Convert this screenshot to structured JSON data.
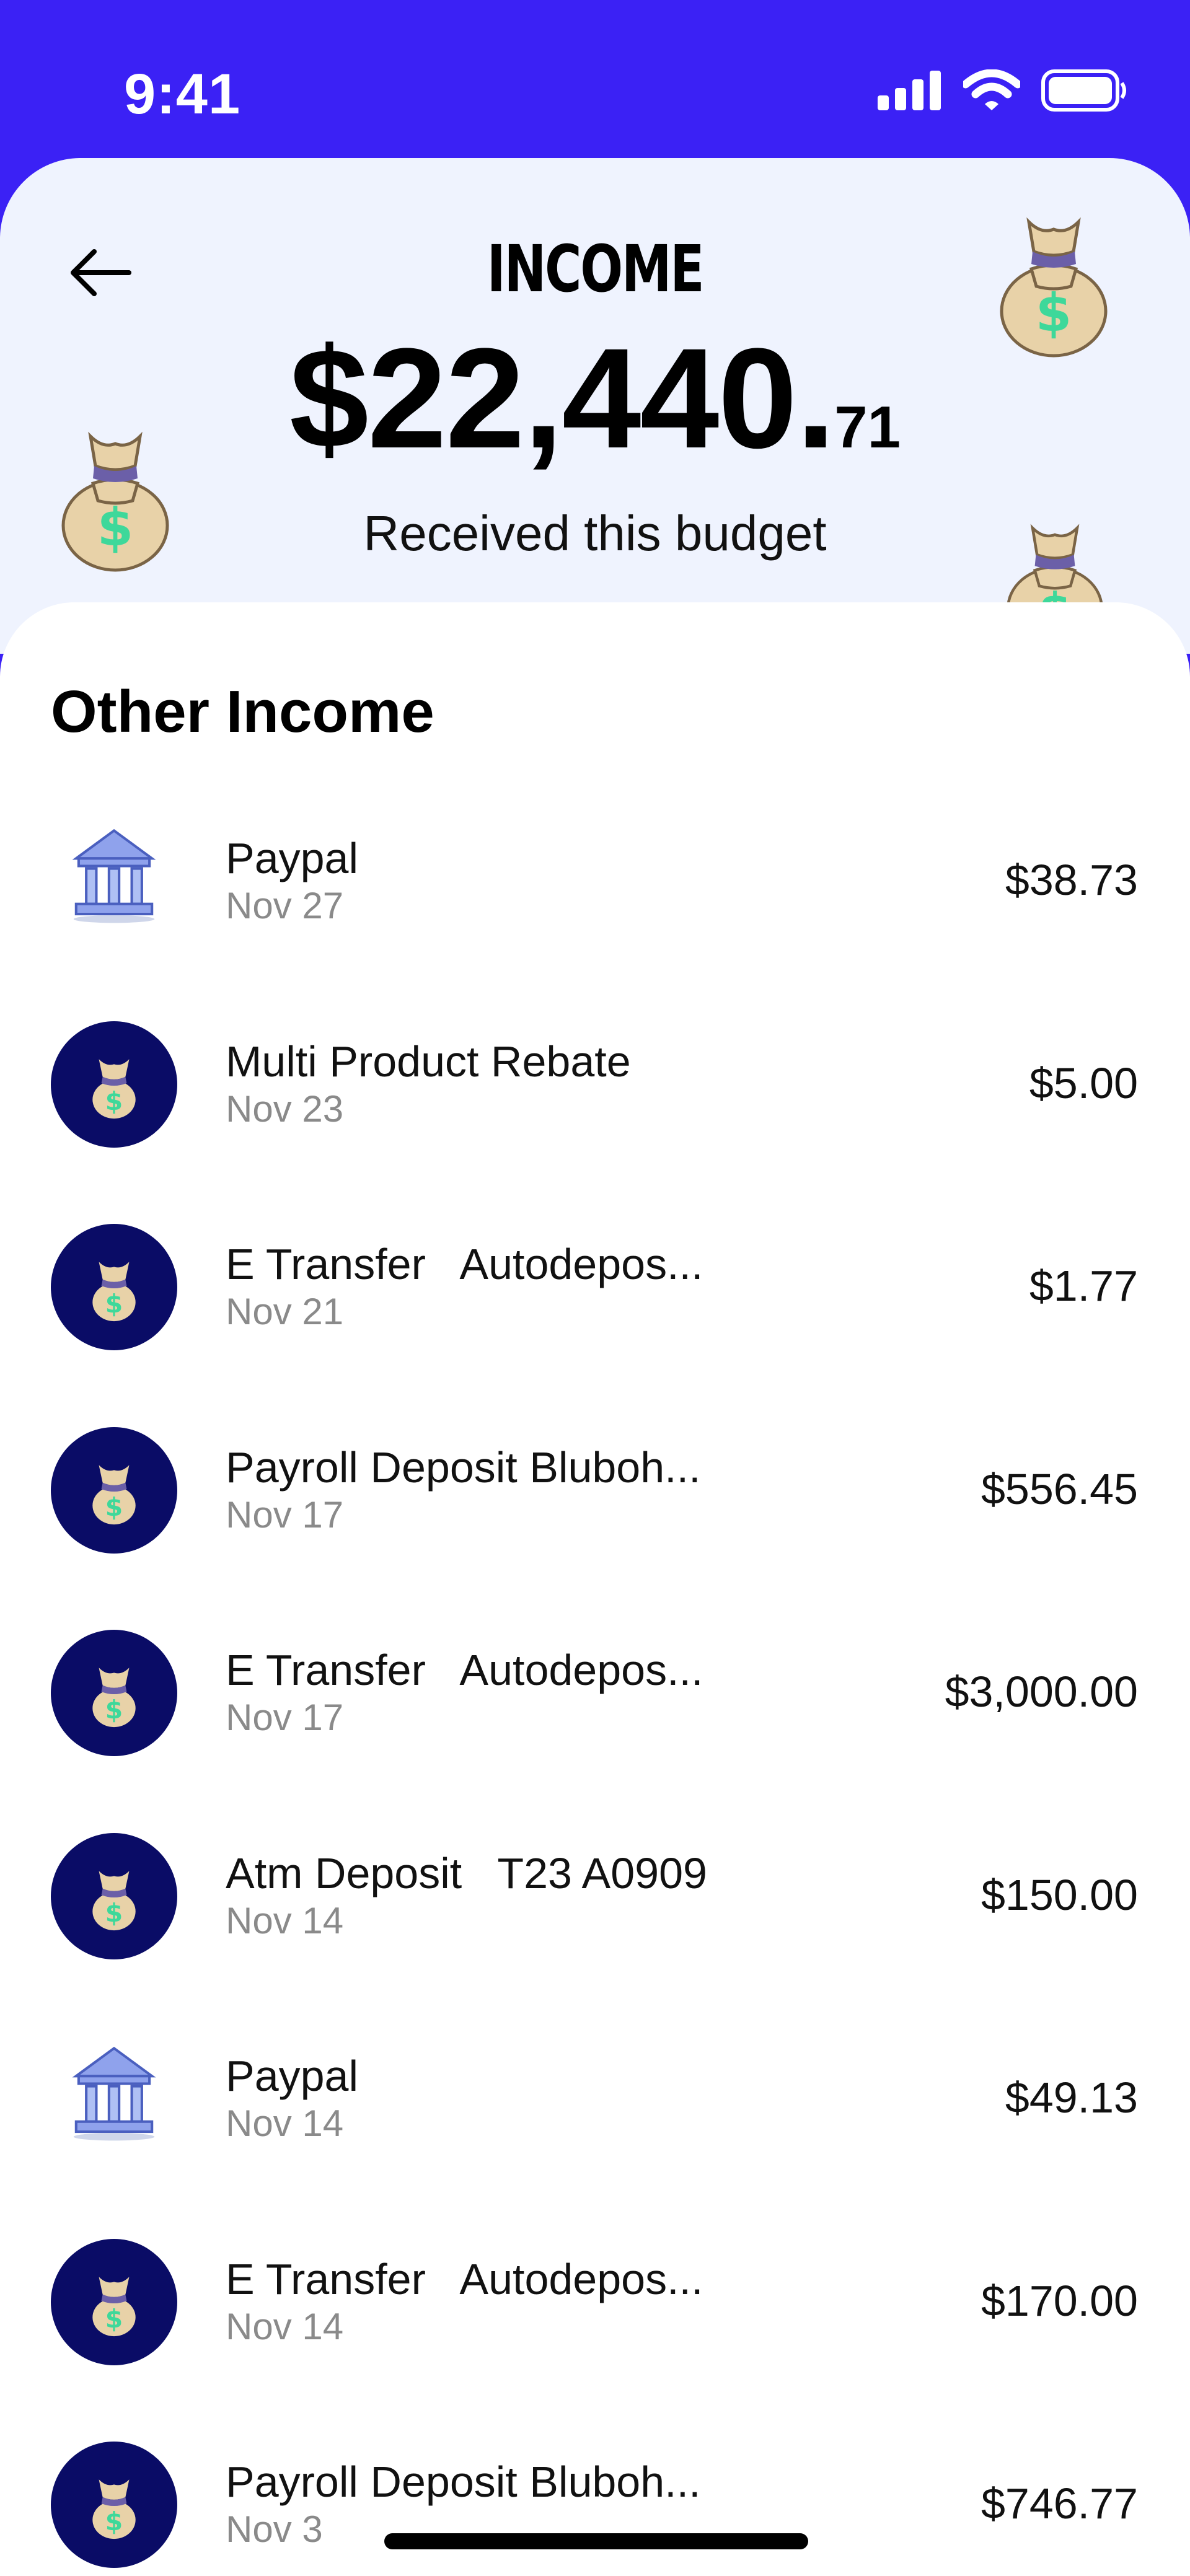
{
  "status_bar": {
    "time": "9:41"
  },
  "header": {
    "title": "INCOME",
    "total_main": "$22,440.",
    "total_cents": "71",
    "caption": "Received this budget"
  },
  "section_title": "Other Income",
  "items": [
    {
      "name": "Paypal",
      "date": "Nov 27",
      "amount": "$38.73",
      "icon": "bank-icon"
    },
    {
      "name": "Multi Product Rebate",
      "date": "Nov 23",
      "amount": "$5.00",
      "icon": "money-bag-icon"
    },
    {
      "name": "E Transfer   Autodepos...",
      "date": "Nov 21",
      "amount": "$1.77",
      "icon": "money-bag-icon"
    },
    {
      "name": "Payroll Deposit Bluboh...",
      "date": "Nov 17",
      "amount": "$556.45",
      "icon": "money-bag-icon"
    },
    {
      "name": "E Transfer   Autodepos...",
      "date": "Nov 17",
      "amount": "$3,000.00",
      "icon": "money-bag-icon"
    },
    {
      "name": "Atm Deposit   T23 A0909",
      "date": "Nov 14",
      "amount": "$150.00",
      "icon": "money-bag-icon"
    },
    {
      "name": "Paypal",
      "date": "Nov 14",
      "amount": "$49.13",
      "icon": "bank-icon"
    },
    {
      "name": "E Transfer   Autodepos...",
      "date": "Nov 14",
      "amount": "$170.00",
      "icon": "money-bag-icon"
    },
    {
      "name": "Payroll Deposit Bluboh...",
      "date": "Nov 3",
      "amount": "$746.77",
      "icon": "money-bag-icon"
    }
  ],
  "colors": {
    "status_bar_bg": "#3B21F5",
    "header_bg": "#EFF3FE",
    "icon_circle_bg": "#0A0C66",
    "money_symbol": "#3ED89A",
    "secondary_text": "#8A8A8A"
  }
}
